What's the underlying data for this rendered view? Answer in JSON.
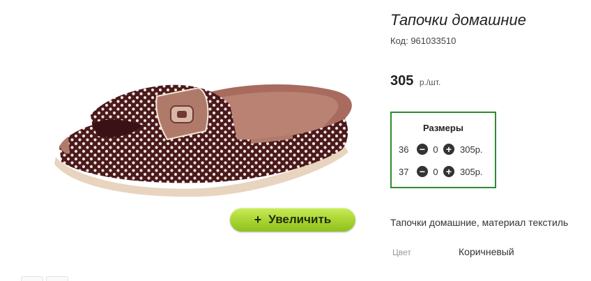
{
  "product": {
    "title": "Тапочки домашние",
    "code": "Код: 961033510",
    "price_value": "305",
    "price_unit": "р./шт.",
    "zoom_plus": "+",
    "zoom_label": "Увеличить",
    "description": "Тапочки домашние, материал текстиль",
    "color_label": "Цвет",
    "color_value": "Коричневый"
  },
  "sizes": {
    "title": "Размеры",
    "minus_glyph": "−",
    "plus_glyph": "+",
    "rows": [
      {
        "size": "36",
        "qty": "0",
        "price": "305р."
      },
      {
        "size": "37",
        "qty": "0",
        "price": "305р."
      }
    ]
  },
  "colors": {
    "accent_border": "#2e8b2e",
    "button_green": "#a8d431",
    "slipper_brown": "#4a1a1e",
    "slipper_tan": "#b07a6a"
  }
}
